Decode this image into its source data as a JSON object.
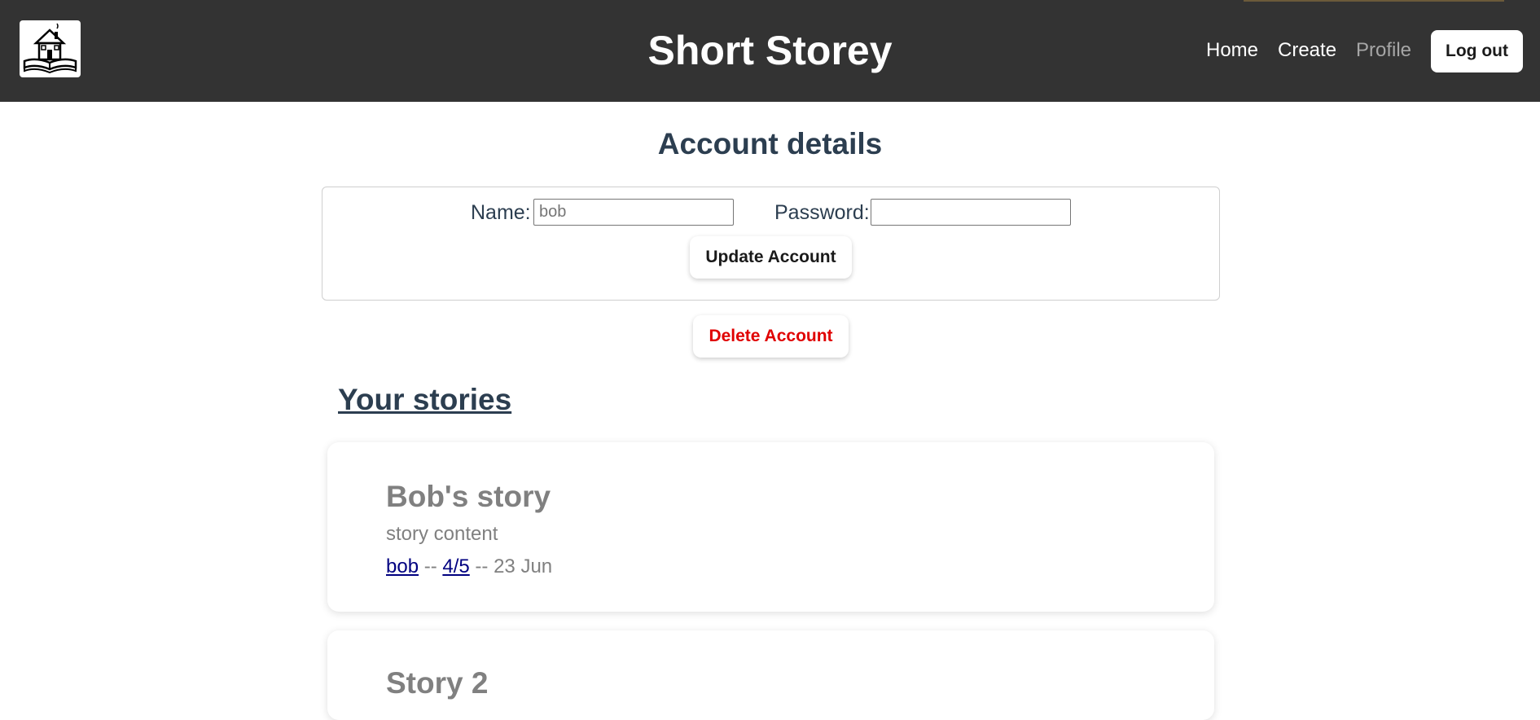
{
  "header": {
    "title": "Short Storey",
    "nav": {
      "home": "Home",
      "create": "Create",
      "profile": "Profile"
    },
    "logout_label": "Log out",
    "logo_icon": "house-on-book-icon"
  },
  "account": {
    "heading": "Account details",
    "name_label": "Name:",
    "name_placeholder": "bob",
    "name_value": "",
    "password_label": "Password:",
    "password_value": "",
    "update_label": "Update Account",
    "delete_label": "Delete Account"
  },
  "stories": {
    "heading": "Your stories",
    "items": [
      {
        "title": "Bob's story",
        "content": "story content",
        "author": "bob",
        "rating": "4/5",
        "date": "23 Jun",
        "separator": "--"
      },
      {
        "title": "Story 2"
      }
    ]
  },
  "colors": {
    "topbar": "#333333",
    "heading": "#2c3e50",
    "delete": "#e00000",
    "link": "#000080",
    "muted": "#808080"
  }
}
